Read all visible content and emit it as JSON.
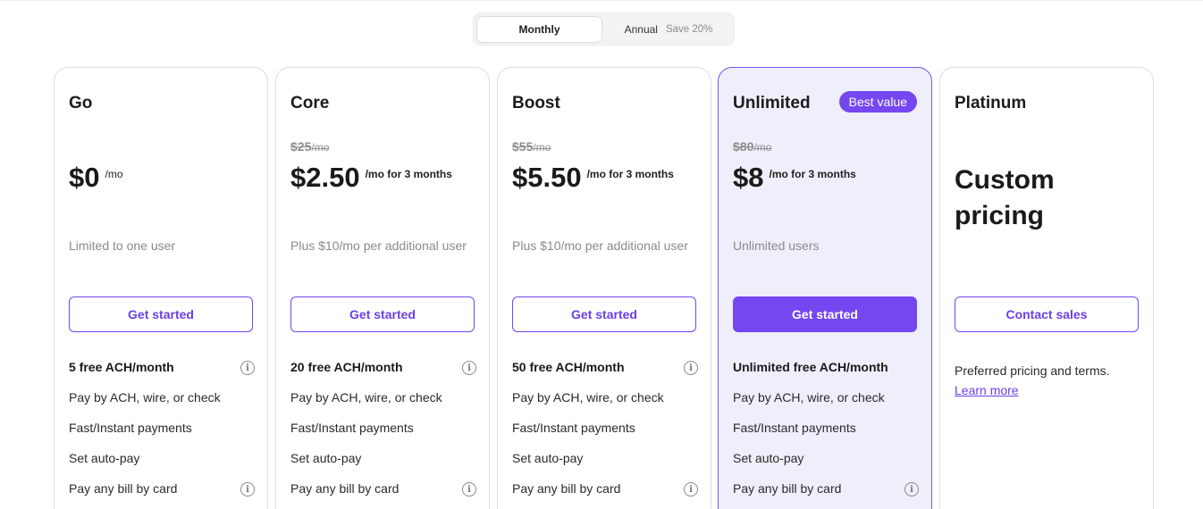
{
  "billing_toggle": {
    "monthly_label": "Monthly",
    "annual_label": "Annual",
    "annual_save": "Save 20%"
  },
  "colors": {
    "accent": "#7447f0",
    "featured_bg": "#efeffc"
  },
  "plans": [
    {
      "name": "Go",
      "price": "$0",
      "price_suffix": "/mo",
      "subtitle": "Limited to one user",
      "cta": "Get started",
      "features": [
        {
          "text": "5 free ACH/month",
          "info": true
        },
        {
          "text": "Pay by ACH, wire, or check",
          "info": false
        },
        {
          "text": "Fast/Instant payments",
          "info": false
        },
        {
          "text": "Set auto-pay",
          "info": false
        },
        {
          "text": "Pay any bill by card",
          "info": true
        }
      ]
    },
    {
      "name": "Core",
      "old_price": "$25",
      "old_price_unit": "/mo",
      "price": "$2.50",
      "price_suffix": "/mo for 3 months",
      "subtitle": "Plus $10/mo per additional user",
      "cta": "Get started",
      "features": [
        {
          "text": "20 free ACH/month",
          "info": true
        },
        {
          "text": "Pay by ACH, wire, or check",
          "info": false
        },
        {
          "text": "Fast/Instant payments",
          "info": false
        },
        {
          "text": "Set auto-pay",
          "info": false
        },
        {
          "text": "Pay any bill by card",
          "info": true
        }
      ]
    },
    {
      "name": "Boost",
      "old_price": "$55",
      "old_price_unit": "/mo",
      "price": "$5.50",
      "price_suffix": "/mo for 3 months",
      "subtitle": "Plus $10/mo per additional user",
      "cta": "Get started",
      "features": [
        {
          "text": "50 free ACH/month",
          "info": true
        },
        {
          "text": "Pay by ACH, wire, or check",
          "info": false
        },
        {
          "text": "Fast/Instant payments",
          "info": false
        },
        {
          "text": "Set auto-pay",
          "info": false
        },
        {
          "text": "Pay any bill by card",
          "info": true
        }
      ]
    },
    {
      "name": "Unlimited",
      "badge": "Best value",
      "old_price": "$80",
      "old_price_unit": "/mo",
      "price": "$8",
      "price_suffix": "/mo for 3 months",
      "subtitle": "Unlimited users",
      "cta": "Get started",
      "features": [
        {
          "text": "Unlimited free ACH/month",
          "info": false
        },
        {
          "text": "Pay by ACH, wire, or check",
          "info": false
        },
        {
          "text": "Fast/Instant payments",
          "info": false
        },
        {
          "text": "Set auto-pay",
          "info": false
        },
        {
          "text": "Pay any bill by card",
          "info": true
        }
      ]
    },
    {
      "name": "Platinum",
      "custom_price": "Custom pricing",
      "cta": "Contact sales",
      "description": "Preferred pricing and terms.",
      "link": "Learn more"
    }
  ]
}
